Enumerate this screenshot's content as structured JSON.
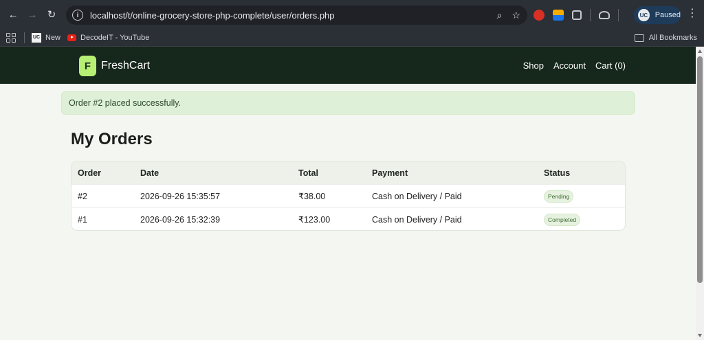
{
  "browser": {
    "url": "localhost/t/online-grocery-store-php-complete/user/orders.php",
    "profile_label": "Paused",
    "profile_avatar": "UC",
    "bookmarks": [
      {
        "label": "New",
        "icon": "uc-favicon"
      },
      {
        "label": "DecodeIT - YouTube",
        "icon": "youtube-icon"
      }
    ],
    "all_bookmarks_label": "All Bookmarks"
  },
  "site": {
    "logo_letter": "F",
    "brand": "FreshCart",
    "nav": {
      "shop": "Shop",
      "account": "Account",
      "cart": "Cart (0)"
    }
  },
  "alert": {
    "message": "Order #2 placed successfully."
  },
  "page_title": "My Orders",
  "orders": {
    "headers": {
      "order": "Order",
      "date": "Date",
      "total": "Total",
      "payment": "Payment",
      "status": "Status"
    },
    "rows": [
      {
        "order": "#2",
        "date": "2026-09-26 15:35:57",
        "total": "₹38.00",
        "payment": "Cash on Delivery / Paid",
        "status": "Pending"
      },
      {
        "order": "#1",
        "date": "2026-09-26 15:32:39",
        "total": "₹123.00",
        "payment": "Cash on Delivery / Paid",
        "status": "Completed"
      }
    ]
  },
  "colors": {
    "header_bg": "#16271b",
    "logo_accent": "#b7ef74",
    "alert_bg": "#dff0d8",
    "page_bg": "#f4f7f1"
  }
}
